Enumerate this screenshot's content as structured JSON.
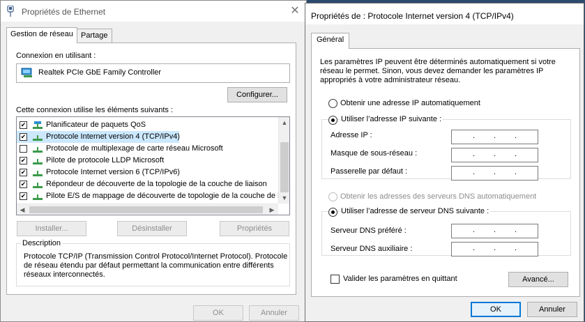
{
  "left_window": {
    "title": "Propriétés de Ethernet",
    "close": "✕",
    "tabs": [
      {
        "label": "Gestion de réseau"
      },
      {
        "label": "Partage"
      }
    ],
    "connect_using_label": "Connexion en utilisant :",
    "adapter_name": "Realtek PCIe GbE Family Controller",
    "configure_button": "Configurer...",
    "elements_label": "Cette connexion utilise les éléments suivants :",
    "items": [
      {
        "label": "Planificateur de paquets QoS",
        "checked": true
      },
      {
        "label": "Protocole Internet version 4 (TCP/IPv4)",
        "checked": true
      },
      {
        "label": "Protocole de multiplexage de carte réseau Microsoft",
        "checked": false
      },
      {
        "label": "Pilote de protocole LLDP Microsoft",
        "checked": true
      },
      {
        "label": "Protocole Internet version 6 (TCP/IPv6)",
        "checked": true
      },
      {
        "label": "Répondeur de découverte de la topologie de la couche de liaison",
        "checked": true
      },
      {
        "label": "Pilote E/S de mappage de découverte de topologie de la couche de lia",
        "checked": true
      }
    ],
    "check_mark": "✔",
    "buttons": {
      "install": "Installer...",
      "uninstall": "Désinstaller",
      "properties": "Propriétés"
    },
    "description_label": "Description",
    "description_lines": [
      "Protocole TCP/IP (Transmission Control Protocol/Internet Protocol). Protocole",
      "de réseau étendu par défaut permettant la communication entre différents",
      "réseaux interconnectés."
    ],
    "ok": "OK",
    "cancel": "Annuler"
  },
  "right_window": {
    "title": "Propriétés de : Protocole Internet version 4 (TCP/IPv4)",
    "tab": "Général",
    "intro_lines": [
      "Les paramètres IP peuvent être déterminés automatiquement si votre",
      "réseau le permet. Sinon, vous devez demander les paramètres IP",
      "appropriés à votre administrateur réseau."
    ],
    "radio_auto_ip": "Obtenir une adresse IP automatiquement",
    "radio_manual_ip": "Utiliser l’adresse IP suivante :",
    "ip_label": "Adresse IP :",
    "mask_label": "Masque de sous-réseau :",
    "gateway_label": "Passerelle par défaut :",
    "radio_auto_dns": "Obtenir les adresses des serveurs DNS automatiquement",
    "radio_manual_dns": "Utiliser l’adresse de serveur DNS suivante :",
    "dns_preferred_label": "Serveur DNS préféré :",
    "dns_alt_label": "Serveur DNS auxiliaire :",
    "dot": ".",
    "validate_label": "Valider les paramètres en quittant",
    "advanced_button": "Avancé...",
    "ok": "OK",
    "cancel": "Annuler"
  }
}
